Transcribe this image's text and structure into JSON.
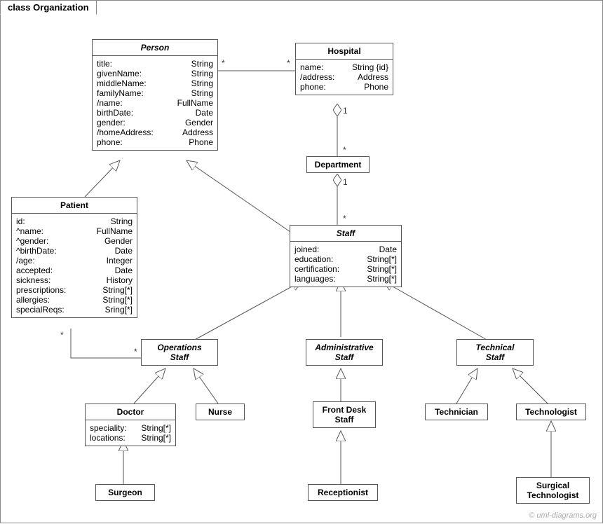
{
  "frame": {
    "title": "class Organization"
  },
  "classes": {
    "person": {
      "name": "Person",
      "attrs": [
        [
          "title:",
          "String"
        ],
        [
          "givenName:",
          "String"
        ],
        [
          "middleName:",
          "String"
        ],
        [
          "familyName:",
          "String"
        ],
        [
          "/name:",
          "FullName"
        ],
        [
          "birthDate:",
          "Date"
        ],
        [
          "gender:",
          "Gender"
        ],
        [
          "/homeAddress:",
          "Address"
        ],
        [
          "phone:",
          "Phone"
        ]
      ]
    },
    "hospital": {
      "name": "Hospital",
      "attrs": [
        [
          "name:",
          "String {id}"
        ],
        [
          "/address:",
          "Address"
        ],
        [
          "phone:",
          "Phone"
        ]
      ]
    },
    "department": {
      "name": "Department"
    },
    "patient": {
      "name": "Patient",
      "attrs": [
        [
          "id:",
          "String"
        ],
        [
          "^name:",
          "FullName"
        ],
        [
          "^gender:",
          "Gender"
        ],
        [
          "^birthDate:",
          "Date"
        ],
        [
          "/age:",
          "Integer"
        ],
        [
          "accepted:",
          "Date"
        ],
        [
          "sickness:",
          "History"
        ],
        [
          "prescriptions:",
          "String[*]"
        ],
        [
          "allergies:",
          "String[*]"
        ],
        [
          "specialReqs:",
          "Sring[*]"
        ]
      ]
    },
    "staff": {
      "name": "Staff",
      "attrs": [
        [
          "joined:",
          "Date"
        ],
        [
          "education:",
          "String[*]"
        ],
        [
          "certification:",
          "String[*]"
        ],
        [
          "languages:",
          "String[*]"
        ]
      ]
    },
    "operations": {
      "name": "Operations",
      "sub": "Staff"
    },
    "admin": {
      "name": "Administrative",
      "sub": "Staff"
    },
    "technical": {
      "name": "Technical",
      "sub": "Staff"
    },
    "doctor": {
      "name": "Doctor",
      "attrs": [
        [
          "speciality:",
          "String[*]"
        ],
        [
          "locations:",
          "String[*]"
        ]
      ]
    },
    "nurse": {
      "name": "Nurse"
    },
    "frontdesk": {
      "name": "Front Desk",
      "sub": "Staff"
    },
    "technician": {
      "name": "Technician"
    },
    "technologist": {
      "name": "Technologist"
    },
    "surgeon": {
      "name": "Surgeon"
    },
    "receptionist": {
      "name": "Receptionist"
    },
    "surgtech": {
      "name": "Surgical",
      "sub": "Technologist"
    }
  },
  "mult": {
    "person_hosp_left": "*",
    "person_hosp_right": "*",
    "hosp_dept_h": "1",
    "hosp_dept_d": "*",
    "dept_staff_d": "1",
    "dept_staff_s": "*",
    "patient_ops_p": "*",
    "patient_ops_o": "*"
  },
  "copyright": "© uml-diagrams.org"
}
